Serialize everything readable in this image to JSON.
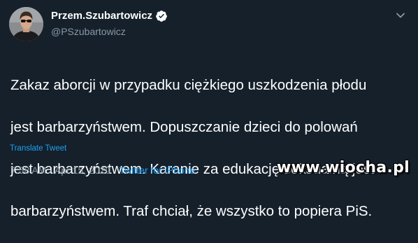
{
  "author": {
    "display_name": "Przem.Szubartowicz",
    "handle": "@PSzubartowicz",
    "verified": true
  },
  "tweet": {
    "text_lines": [
      "Zakaz aborcji w przypadku ciężkiego uszkodzenia płodu",
      "jest barbarzyństwem. Dopuszczanie dzieci do polowań",
      "jest barbarzyństwem. Karanie za edukację seksualną jest",
      "barbarzyństwem. Traf chciał, że wszystko to popiera PiS."
    ],
    "translate_label": "Translate Tweet",
    "time": "7:58 AM",
    "separator": "·",
    "date": "Apr 15, 2020",
    "source": "Twitter for iPhone"
  },
  "watermark": "www.wiocha.pl",
  "colors": {
    "background": "#15202b",
    "accent": "#1da1f2",
    "secondary_text": "#8899a6"
  },
  "icons": {
    "verified": "verified-badge-icon",
    "more": "chevron-down-icon",
    "avatar": "avatar"
  }
}
